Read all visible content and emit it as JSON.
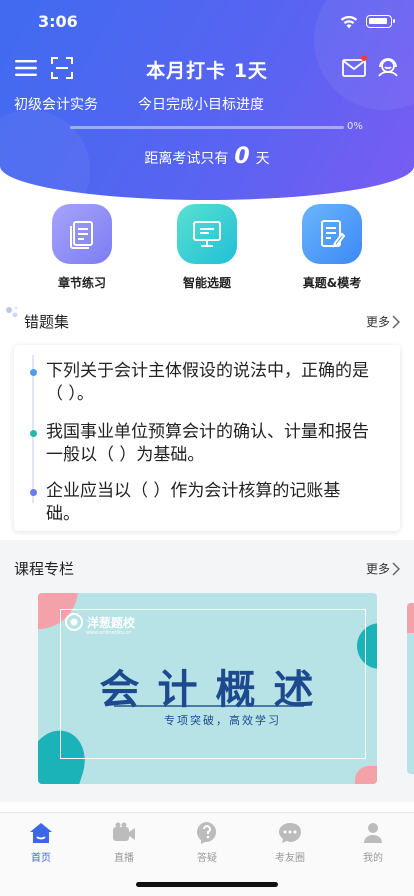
{
  "status_bar": {
    "time": "3:06"
  },
  "header": {
    "title": "本月打卡 1天",
    "subject": "初级会计实务",
    "goal_label": "今日完成小目标进度",
    "progress_percent_text": "0%",
    "progress_fraction": 0,
    "exam_prefix": "距离考试只有",
    "exam_days": "0",
    "exam_suffix": "天",
    "has_unread_mail": true
  },
  "features": [
    {
      "label": "章节练习",
      "icon": "book-icon"
    },
    {
      "label": "智能选题",
      "icon": "monitor-icon"
    },
    {
      "label": "真题&模考",
      "icon": "exam-paper-icon"
    }
  ],
  "wrong_set": {
    "title": "错题集",
    "more": "更多",
    "items": [
      "下列关于会计主体假设的说法中，正确的是（ ）。",
      "我国事业单位预算会计的确认、计量和报告一般以（ ）为基础。",
      "企业应当以（ ）作为会计核算的记账基础。"
    ]
  },
  "courses": {
    "title": "课程专栏",
    "more": "更多",
    "card": {
      "brand": "洋葱题校",
      "brand_sub": "www.onlinetiku.cn",
      "title": "会计概述",
      "subtitle": "专项突破，高效学习"
    }
  },
  "tabbar": {
    "items": [
      {
        "label": "首页",
        "icon": "home-icon",
        "active": true
      },
      {
        "label": "直播",
        "icon": "video-icon",
        "active": false
      },
      {
        "label": "答疑",
        "icon": "question-icon",
        "active": false
      },
      {
        "label": "考友圈",
        "icon": "chat-icon",
        "active": false
      },
      {
        "label": "我的",
        "icon": "person-icon",
        "active": false
      }
    ]
  },
  "colors": {
    "header_start": "#3f6bf0",
    "header_end": "#7a5cf3",
    "tab_active": "#3b67e8",
    "tab_inactive": "#999999"
  }
}
